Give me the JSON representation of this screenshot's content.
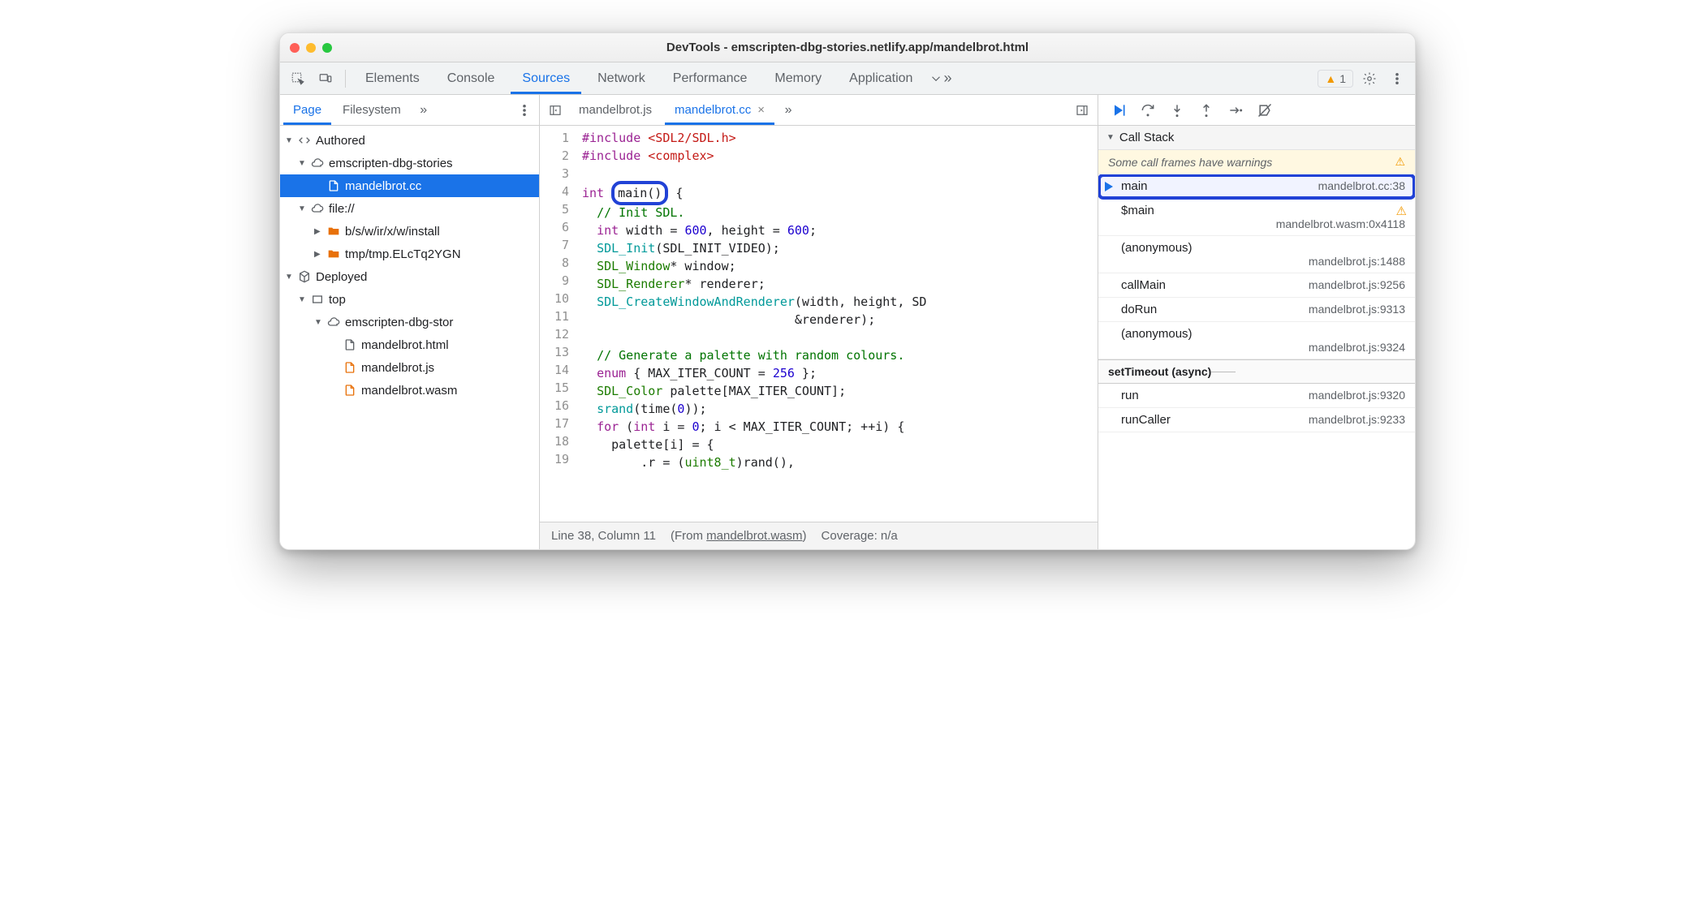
{
  "title": "DevTools - emscripten-dbg-stories.netlify.app/mandelbrot.html",
  "mainTabs": [
    "Elements",
    "Console",
    "Sources",
    "Network",
    "Performance",
    "Memory",
    "Application"
  ],
  "mainActive": "Sources",
  "warnCount": "1",
  "navTabs": [
    "Page",
    "Filesystem"
  ],
  "navActive": "Page",
  "tree": {
    "authored": "Authored",
    "origin1": "emscripten-dbg-stories",
    "file_cc": "mandelbrot.cc",
    "fileScheme": "file://",
    "folder1": "b/s/w/ir/x/w/install",
    "folder2": "tmp/tmp.ELcTq2YGN",
    "deployed": "Deployed",
    "top": "top",
    "origin2": "emscripten-dbg-stor",
    "file_html": "mandelbrot.html",
    "file_js": "mandelbrot.js",
    "file_wasm": "mandelbrot.wasm"
  },
  "editorTabs": {
    "tab1": "mandelbrot.js",
    "tab2": "mandelbrot.cc"
  },
  "code": {
    "l1a": "#include ",
    "l1b": "<SDL2/SDL.h>",
    "l2a": "#include ",
    "l2b": "<complex>",
    "l4_int": "int",
    "l4_main": "main",
    "l4_rest": "() {",
    "l5": "// Init SDL.",
    "l6a": "int",
    "l6b": " width = ",
    "l6c": "600",
    "l6d": ", height = ",
    "l6e": "600",
    "l6f": ";",
    "l7a": "SDL_Init",
    "l7b": "(SDL_INIT_VIDEO);",
    "l8a": "SDL_Window",
    "l8b": "* window;",
    "l9a": "SDL_Renderer",
    "l9b": "* renderer;",
    "l10a": "SDL_CreateWindowAndRenderer",
    "l10b": "(width, height, SD",
    "l11": "&renderer);",
    "l13": "// Generate a palette with random colours.",
    "l14a": "enum",
    "l14b": " { MAX_ITER_COUNT = ",
    "l14c": "256",
    "l14d": " };",
    "l15a": "SDL_Color",
    "l15b": " palette[MAX_ITER_COUNT];",
    "l16a": "srand",
    "l16b": "(time(",
    "l16c": "0",
    "l16d": "));",
    "l17a": "for",
    "l17b": " (",
    "l17c": "int",
    "l17d": " i = ",
    "l17e": "0",
    "l17f": "; i < MAX_ITER_COUNT; ++i) {",
    "l18": "palette[i] = {",
    "l19a": ".r = (",
    "l19b": "uint8_t",
    "l19c": ")rand(),"
  },
  "status": {
    "pos": "Line 38, Column 11",
    "fromLabel": "(From ",
    "fromFile": "mandelbrot.wasm",
    "fromEnd": ")",
    "coverage": "Coverage: n/a"
  },
  "callStackLabel": "Call Stack",
  "warnMsg": "Some call frames have warnings",
  "stack": [
    {
      "name": "main",
      "loc": "mandelbrot.cc:38",
      "current": true
    },
    {
      "name": "$main",
      "loc": "mandelbrot.wasm:0x4118",
      "warn": true,
      "twoLine": true
    },
    {
      "name": "(anonymous)",
      "loc": "mandelbrot.js:1488",
      "twoLine": true
    },
    {
      "name": "callMain",
      "loc": "mandelbrot.js:9256"
    },
    {
      "name": "doRun",
      "loc": "mandelbrot.js:9313"
    },
    {
      "name": "(anonymous)",
      "loc": "mandelbrot.js:9324",
      "twoLine": true
    }
  ],
  "asyncLabel": "setTimeout (async)",
  "stack2": [
    {
      "name": "run",
      "loc": "mandelbrot.js:9320"
    },
    {
      "name": "runCaller",
      "loc": "mandelbrot.js:9233"
    }
  ]
}
